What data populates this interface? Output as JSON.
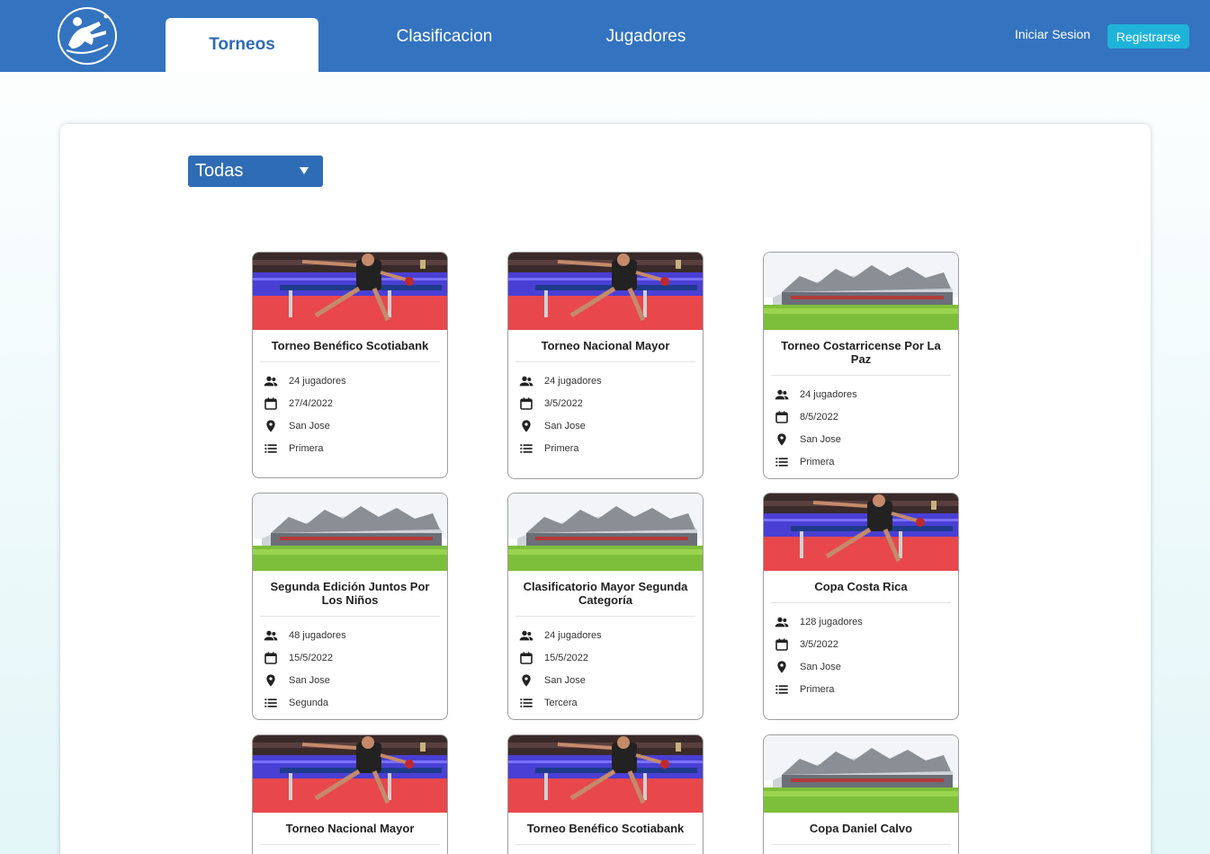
{
  "nav": {
    "tabs": [
      {
        "label": "Torneos"
      },
      {
        "label": "Clasificacion"
      },
      {
        "label": "Jugadores"
      }
    ],
    "login": "Iniciar Sesion",
    "register": "Registrarse",
    "logo_icon": "table-tennis-player-logo"
  },
  "filter": {
    "selected": "Todas"
  },
  "colors": {
    "nav_bg": "#3373c0",
    "active_tab_text": "#2f6cb6",
    "register_bg": "#1fb3d9",
    "filter_bg": "#2f6cb6"
  },
  "cards": [
    {
      "title": "Torneo Benéfico Scotiabank",
      "image": "table-tennis-player-photo",
      "players": "24 jugadores",
      "date": "27/4/2022",
      "location": "San Jose",
      "category": "Primera"
    },
    {
      "title": "Torneo Nacional Mayor",
      "image": "table-tennis-player-photo",
      "players": "24 jugadores",
      "date": "3/5/2022",
      "location": "San Jose",
      "category": "Primera"
    },
    {
      "title": "Torneo Costarricense Por La Paz",
      "image": "stadium-photo",
      "players": "24 jugadores",
      "date": "8/5/2022",
      "location": "San Jose",
      "category": "Primera"
    },
    {
      "title": "Segunda Edición Juntos Por Los Niños",
      "image": "stadium-photo",
      "players": "48 jugadores",
      "date": "15/5/2022",
      "location": "San Jose",
      "category": "Segunda"
    },
    {
      "title": "Clasificatorio Mayor Segunda Categoría",
      "image": "stadium-photo",
      "players": "24 jugadores",
      "date": "15/5/2022",
      "location": "San Jose",
      "category": "Tercera"
    },
    {
      "title": "Copa Costa Rica",
      "image": "table-tennis-player-photo",
      "players": "128 jugadores",
      "date": "3/5/2022",
      "location": "San Jose",
      "category": "Primera"
    },
    {
      "title": "Torneo Nacional Mayor",
      "image": "table-tennis-player-photo"
    },
    {
      "title": "Torneo Benéfico Scotiabank",
      "image": "table-tennis-player-photo"
    },
    {
      "title": "Copa Daniel Calvo",
      "image": "stadium-photo"
    }
  ]
}
